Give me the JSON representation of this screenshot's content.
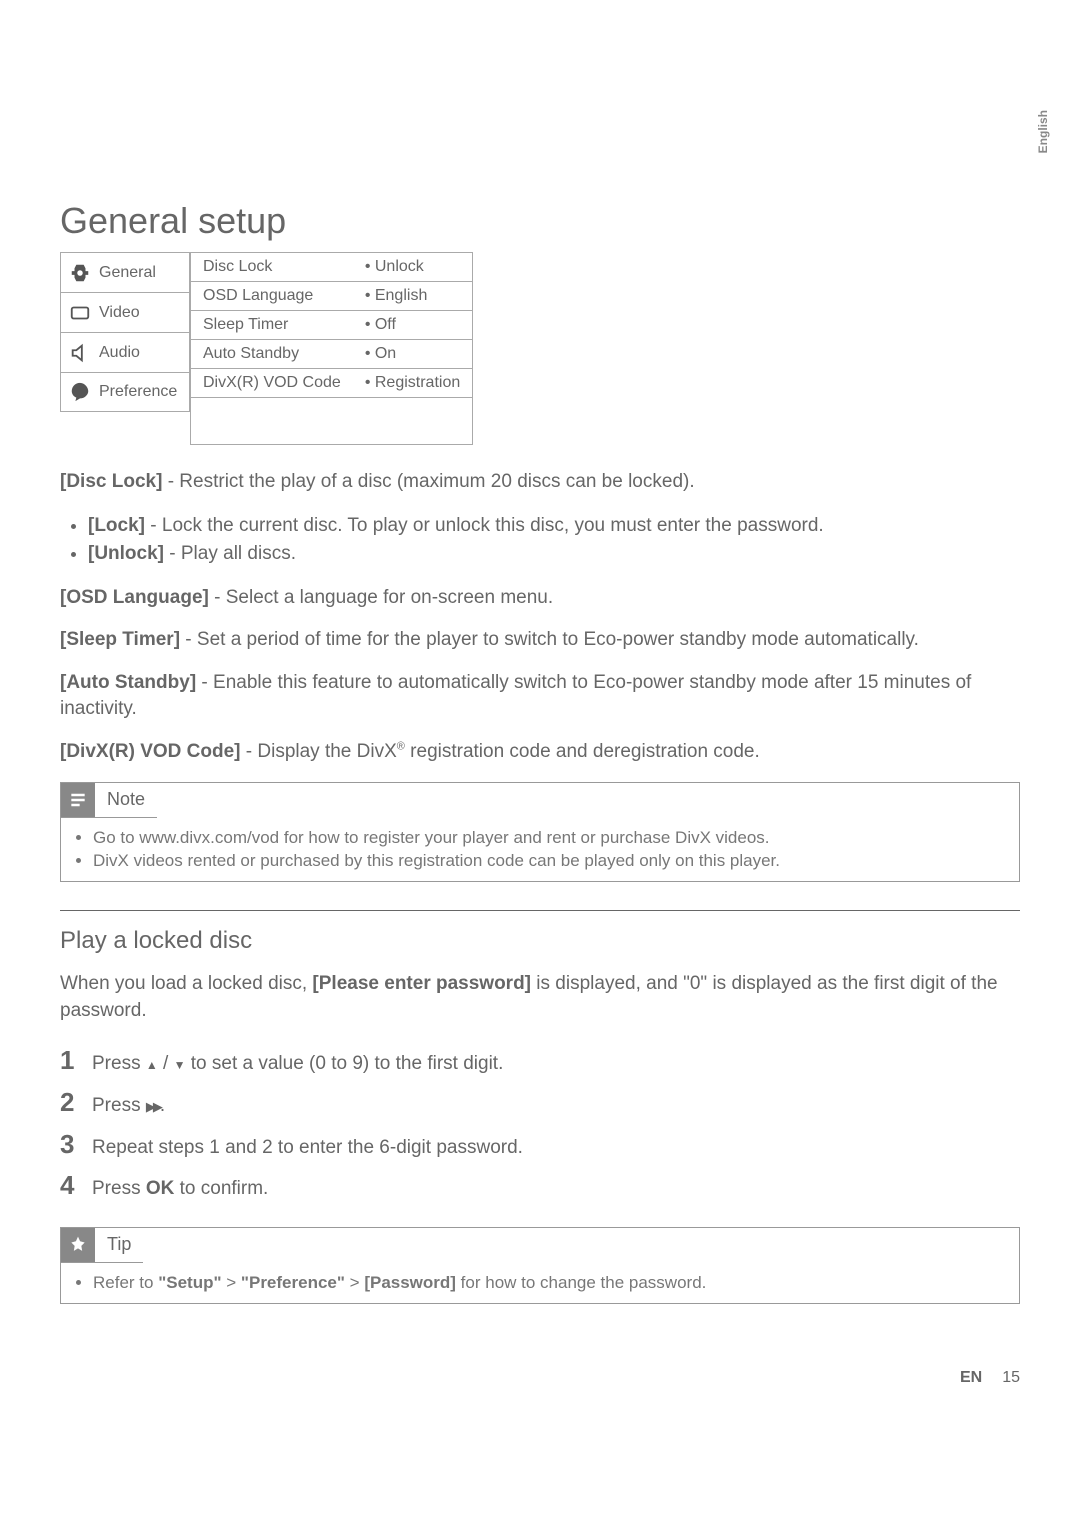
{
  "lang_tab": "English",
  "heading": "General setup",
  "menu": {
    "nav": [
      {
        "label": "General",
        "icon": "settings-icon"
      },
      {
        "label": "Video",
        "icon": "video-icon"
      },
      {
        "label": "Audio",
        "icon": "audio-icon"
      },
      {
        "label": "Preference",
        "icon": "pref-icon"
      }
    ],
    "rows": [
      {
        "label": "Disc Lock",
        "value": "• Unlock"
      },
      {
        "label": "OSD Language",
        "value": "• English"
      },
      {
        "label": "Sleep Timer",
        "value": "• Off"
      },
      {
        "label": "Auto Standby",
        "value": "• On"
      },
      {
        "label": "DivX(R) VOD Code",
        "value": "• Registration"
      }
    ]
  },
  "disc_lock": {
    "lead_bold": "[Disc Lock]",
    "lead_rest": " - Restrict the play of a disc (maximum 20 discs can be locked).",
    "items": [
      {
        "b": "[Lock]",
        "t": " - Lock the current disc. To play or unlock this disc, you must enter the password."
      },
      {
        "b": "[Unlock]",
        "t": " - Play all discs."
      }
    ]
  },
  "osd_lang": {
    "b": "[OSD Language]",
    "t": " - Select a language for on-screen menu."
  },
  "sleep_timer": {
    "b": "[Sleep Timer]",
    "t": " - Set a period of time for the player to switch to Eco-power standby mode automatically."
  },
  "auto_standby": {
    "b": "[Auto Standby]",
    "t": " - Enable this feature to automatically switch to Eco-power standby mode after 15 minutes of inactivity."
  },
  "divx_code": {
    "b": "[DivX(R) VOD Code]",
    "pre": " - Display the DivX",
    "sup": "®",
    "post": " registration code and deregistration code."
  },
  "note": {
    "title": "Note",
    "items": [
      "Go to www.divx.com/vod for how to register your player and rent or purchase DivX videos.",
      "DivX videos rented or purchased by this registration code can be played only on this player."
    ]
  },
  "locked_disc": {
    "heading": "Play a locked disc",
    "intro_a": "When you load a locked disc, ",
    "intro_bold": "[Please enter password]",
    "intro_b": " is displayed, and \"0\" is displayed as the first digit of the password.",
    "steps": [
      {
        "n": "1",
        "pre": "Press ",
        "mid": " / ",
        "post": " to set a value (0 to 9) to the first digit."
      },
      {
        "n": "2",
        "pre": "Press ",
        "post": "."
      },
      {
        "n": "3",
        "t": "Repeat steps 1 and 2 to enter the 6-digit password."
      },
      {
        "n": "4",
        "pre": "Press ",
        "b": "OK",
        "post": " to confirm."
      }
    ]
  },
  "tip": {
    "title": "Tip",
    "item_pre": "Refer to ",
    "b1": "\"Setup\"",
    "sep1": " > ",
    "b2": "\"Preference\"",
    "sep2": " > ",
    "b3": "[Password]",
    "item_post": " for how to change the password."
  },
  "footer": {
    "label": "EN",
    "page": "15"
  }
}
